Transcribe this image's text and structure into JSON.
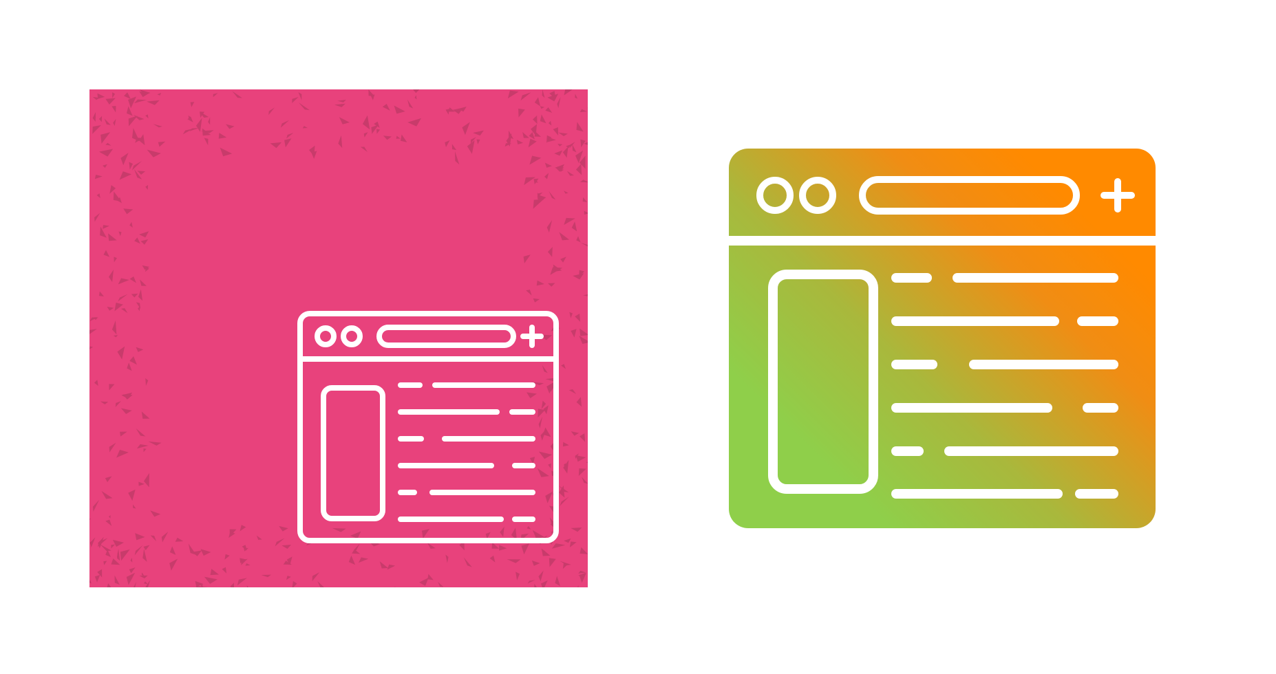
{
  "icons": [
    {
      "name": "browser-layout-line-icon",
      "style": "outline",
      "background": "#e8427c",
      "texture": "#c23a68",
      "stroke": "#ffffff"
    },
    {
      "name": "browser-layout-gradient-icon",
      "style": "glyph-gradient",
      "gradient": [
        "#8fcf4a",
        "#ff8a00"
      ],
      "stroke": "#ffffff"
    }
  ]
}
